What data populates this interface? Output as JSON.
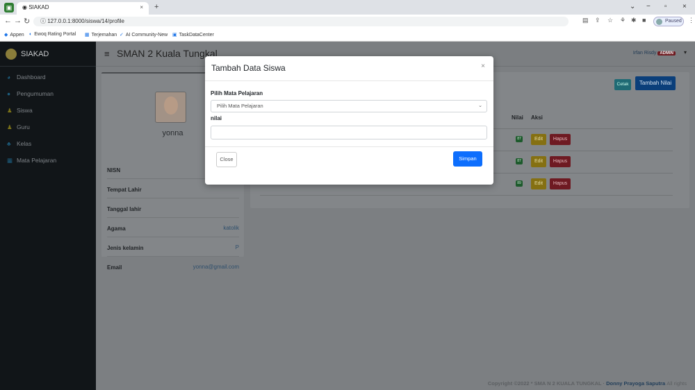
{
  "browser": {
    "tab_title": "SIAKAD",
    "url": "127.0.0.1:8000/siswa/14/profile",
    "paused_label": "Paused",
    "bookmarks": [
      "Appen",
      "Ewoq Rating Portal",
      "Terjemahan",
      "AI Community-New",
      "TaskDataCenter"
    ]
  },
  "sidebar": {
    "brand": "SIAKAD",
    "items": [
      {
        "label": "Dashboard",
        "icon": "dashboard-icon"
      },
      {
        "label": "Pengumuman",
        "icon": "announcement-icon"
      },
      {
        "label": "Siswa",
        "icon": "student-icon"
      },
      {
        "label": "Guru",
        "icon": "teacher-icon"
      },
      {
        "label": "Kelas",
        "icon": "class-icon"
      },
      {
        "label": "Mata Pelajaran",
        "icon": "subject-icon"
      }
    ]
  },
  "header": {
    "school": "SMAN 2 Kuala Tungkal",
    "user": "Irfan Risdy",
    "role_badge": "ADMIN"
  },
  "profile": {
    "name": "yonna",
    "fields": [
      {
        "key": "NISN",
        "value": ""
      },
      {
        "key": "Tempat Lahir",
        "value": ""
      },
      {
        "key": "Tanggal lahir",
        "value": ""
      },
      {
        "key": "Agama",
        "value": "katolik"
      },
      {
        "key": "Jenis kelamin",
        "value": "P"
      },
      {
        "key": "Email",
        "value": "yonna@gmail.com"
      }
    ]
  },
  "grades": {
    "cetak_label": "Cetak",
    "tambah_label": "Tambah Nilai",
    "col_nilai": "Nilai",
    "col_aksi": "Aksi",
    "rows": [
      {
        "nilai": "87",
        "edit": "Edit",
        "hapus": "Hapus"
      },
      {
        "nilai": "87",
        "edit": "Edit",
        "hapus": "Hapus"
      },
      {
        "nilai": "89",
        "edit": "Edit",
        "hapus": "Hapus"
      }
    ]
  },
  "footer": {
    "text": "Copyright ©2022 * SMA N 2 KUALA TUNGKAL ·",
    "author": "Donny Prayoga Saputra",
    "suffix": "All rights"
  },
  "modal": {
    "title": "Tambah Data Siswa",
    "subject_label": "Pilih Mata Pelajaran",
    "subject_value": "Pilih Mata Pelajaran",
    "nilai_label": "nilai",
    "nilai_value": "",
    "close_label": "Close",
    "submit_label": "Simpan"
  }
}
